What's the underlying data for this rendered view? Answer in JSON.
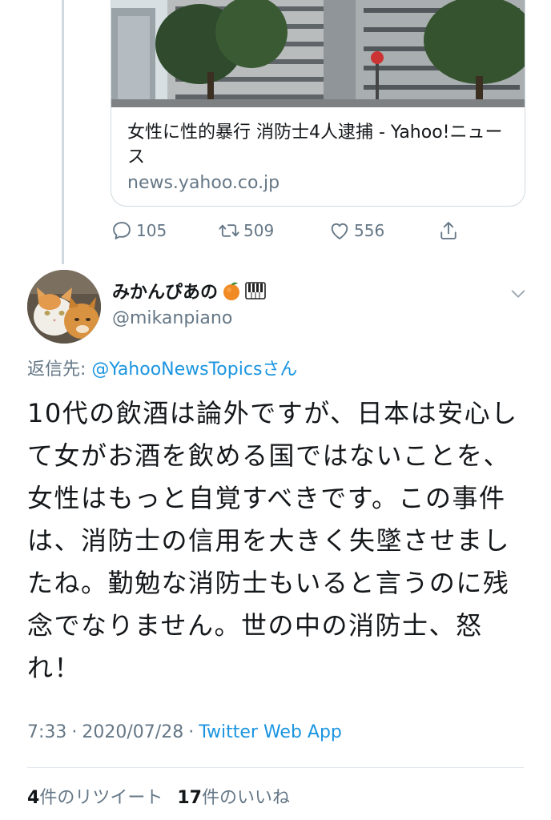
{
  "link_card": {
    "title": "女性に性的暴行 消防士4人逮捕 - Yahoo!ニュース",
    "domain": "news.yahoo.co.jp"
  },
  "actions": {
    "reply_count": "105",
    "retweet_count": "509",
    "like_count": "556"
  },
  "tweet": {
    "display_name": "みかんぴあの",
    "name_emojis": [
      "orange-emoji",
      "piano-keys-emoji"
    ],
    "handle": "@mikanpiano",
    "reply_label": "返信先: ",
    "reply_target": "@YahooNewsTopics",
    "reply_suffix": "さん",
    "text": "10代の飲酒は論外ですが、日本は安心して女がお酒を飲める国ではないことを、女性はもっと自覚すべきです。この事件は、消防士の信用を大きく失墜させましたね。勤勉な消防士もいると言うのに残念でなりません。世の中の消防士、怒れ！",
    "time": "7:33",
    "date": "2020/07/28",
    "source": "Twitter Web App"
  },
  "stats": {
    "retweets_num": "4",
    "retweets_label": "件のリツイート",
    "likes_num": "17",
    "likes_label": "件のいいね"
  },
  "colors": {
    "link_blue": "#1b95e0",
    "secondary_gray": "#657786",
    "border": "#cfd9de"
  }
}
